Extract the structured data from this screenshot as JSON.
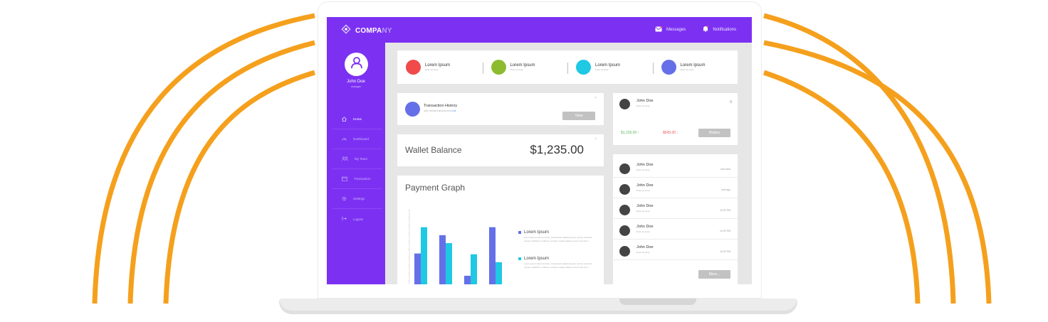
{
  "colors": {
    "brand": "#7c31f2",
    "wave": "#f5a01d",
    "screen_bg": "#e6e6e6"
  },
  "header": {
    "brand_prefix": "COMPA",
    "brand_suffix": "NY",
    "messages": "Messages",
    "notifications": "Notifications"
  },
  "sidebar": {
    "user_name": "John Doe",
    "user_role": "manager",
    "items": [
      {
        "label": "Home",
        "icon": "home-icon"
      },
      {
        "label": "Dashboard",
        "icon": "dashboard-icon"
      },
      {
        "label": "My Team",
        "icon": "team-icon"
      },
      {
        "label": "Transaction",
        "icon": "wallet-icon"
      },
      {
        "label": "Settings",
        "icon": "gear-icon"
      },
      {
        "label": "Logout",
        "icon": "logout-icon"
      }
    ]
  },
  "stats": [
    {
      "title": "Lorem Ipsum",
      "sub": "Dolor sit amet",
      "color": "#f04a4a"
    },
    {
      "title": "Lorem Ipsum",
      "sub": "Dolor sit amet",
      "color": "#8dbb2f"
    },
    {
      "title": "Lorem Ipsum",
      "sub": "Dolor sit amet",
      "color": "#1fc8e3"
    },
    {
      "title": "Lorem Ipsum",
      "sub": "Dolor sit amet",
      "color": "#6570e8"
    }
  ],
  "transaction": {
    "title": "Transaction History",
    "sub": "John received amount from",
    "link": "Link",
    "view_label": "View"
  },
  "wallet": {
    "label": "Wallet Balance",
    "value": "$1,235.00"
  },
  "payment": {
    "title": "Payment Graph",
    "legend": [
      {
        "label": "Lorem Ipsum",
        "color": "#6570e8",
        "text": "Lorem ipsum dolor sit amet, consectetur adipiscing elit, sed do eiusmod tempor incididunt ut labore et dolore magna aliqua ut enim ad minim"
      },
      {
        "label": "Lorem Ipsum",
        "color": "#1fc8e3",
        "text": "Lorem ipsum dolor sit amet, consectetur adipiscing elit, sed do eiusmod tempor incididunt ut labore et dolore magna aliqua ut enim ad minim"
      }
    ]
  },
  "chart_data": {
    "type": "bar",
    "categories": [
      "",
      "",
      "",
      ""
    ],
    "series": [
      {
        "values": [
          45,
          68,
          17,
          78
        ]
      },
      {
        "values": [
          78,
          58,
          44,
          34
        ]
      }
    ],
    "ylim": [
      0,
      100
    ],
    "grid": false
  },
  "profile": {
    "name": "John Doe",
    "sub": "Dolor sit amet",
    "count": "0",
    "amount_in": "$1,235.00",
    "amount_out": "$545.00",
    "history_label": "History"
  },
  "people": [
    {
      "name": "John Doe",
      "sub": "Dolor sit amet",
      "time": "Just Now"
    },
    {
      "name": "John Doe",
      "sub": "Dolor sit amet",
      "time": "Just ago"
    },
    {
      "name": "John Doe",
      "sub": "Dolor sit amet",
      "time": "10:32 PM"
    },
    {
      "name": "John Doe",
      "sub": "Dolor sit amet",
      "time": "10:32 PM"
    },
    {
      "name": "John Doe",
      "sub": "Dolor sit amet",
      "time": "10:32 PM"
    }
  ],
  "more_label": "More..."
}
